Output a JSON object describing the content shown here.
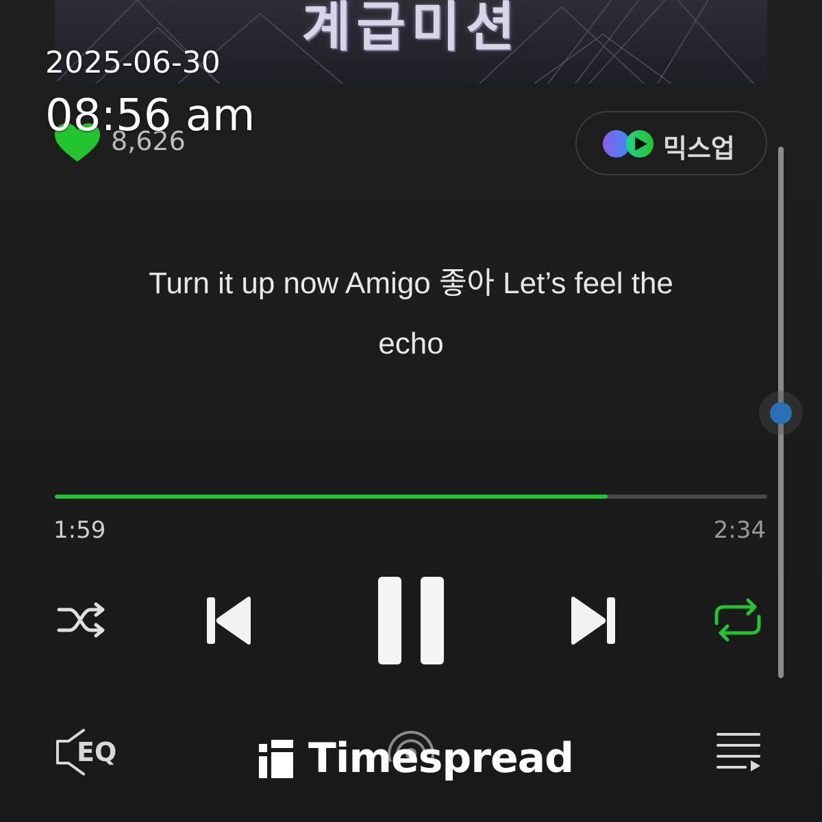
{
  "banner": {
    "title": "계급미션"
  },
  "timestamp": {
    "date": "2025-06-30",
    "time": "08:56 am"
  },
  "like": {
    "count": "8,626",
    "color": "#22c52e"
  },
  "mixup": {
    "label": "믹스업"
  },
  "lyrics": {
    "line1": "Turn it up now Amigo 좋아 Let’s feel the",
    "line2": "echo"
  },
  "playback": {
    "elapsed": "1:59",
    "total": "2:34",
    "progress_fraction": 0.776,
    "accent_color": "#22c52e"
  },
  "controls": {
    "shuffle": "shuffle-icon",
    "previous": "skip-previous-icon",
    "pause": "pause-icon",
    "next": "skip-next-icon",
    "repeat": "repeat-icon"
  },
  "bottom_bar": {
    "eq_label": "EQ",
    "queue": "playlist-icon"
  },
  "watermark": {
    "text": "Timespread"
  }
}
